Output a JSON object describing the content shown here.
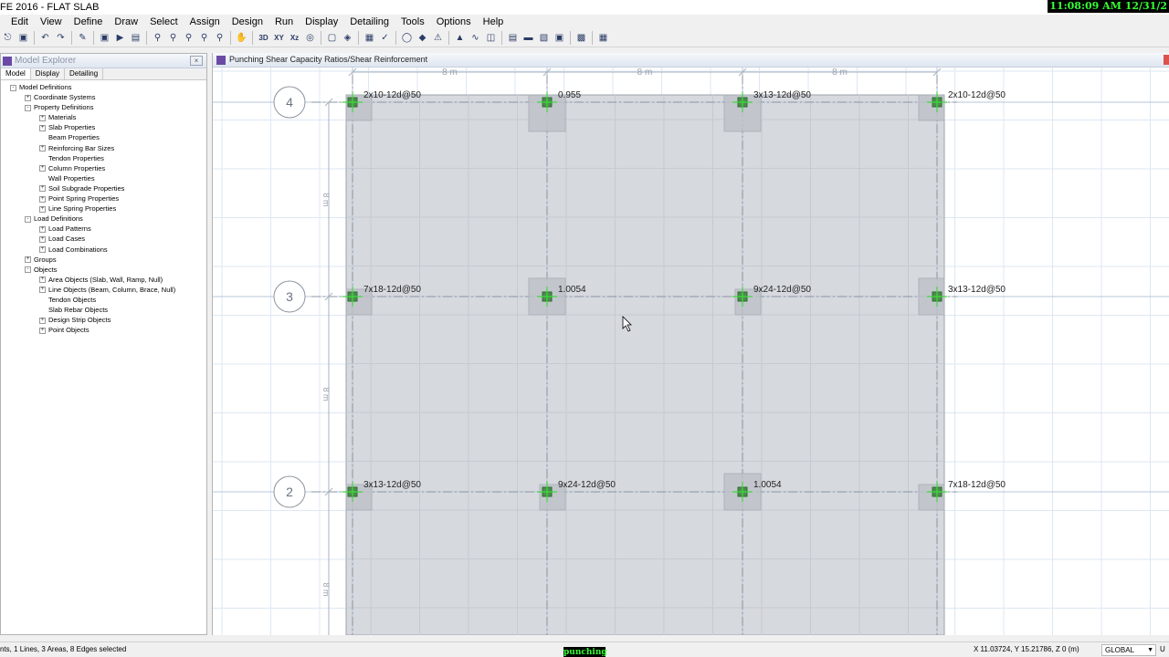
{
  "app": {
    "title": "FE 2016 - FLAT SLAB",
    "clock": "11:08:09 AM 12/31/2"
  },
  "menu": [
    "Edit",
    "View",
    "Define",
    "Draw",
    "Select",
    "Assign",
    "Design",
    "Run",
    "Display",
    "Detailing",
    "Tools",
    "Options",
    "Help"
  ],
  "toolbar": {
    "view_3d": "3D",
    "view_xy": "XY",
    "view_xz": "Xz"
  },
  "model_explorer": {
    "title": "Model Explorer",
    "tabs": [
      "Model",
      "Display",
      "Detailing"
    ],
    "tree": [
      {
        "label": "Model Definitions",
        "level": 0,
        "exp": "-"
      },
      {
        "label": "Coordinate Systems",
        "level": 1,
        "exp": "+"
      },
      {
        "label": "Property Definitions",
        "level": 1,
        "exp": "-"
      },
      {
        "label": "Materials",
        "level": 2,
        "exp": "+"
      },
      {
        "label": "Slab Properties",
        "level": 2,
        "exp": "+"
      },
      {
        "label": "Beam Properties",
        "level": 2,
        "exp": ""
      },
      {
        "label": "Reinforcing Bar Sizes",
        "level": 2,
        "exp": "+"
      },
      {
        "label": "Tendon Properties",
        "level": 2,
        "exp": ""
      },
      {
        "label": "Column Properties",
        "level": 2,
        "exp": "+"
      },
      {
        "label": "Wall Properties",
        "level": 2,
        "exp": ""
      },
      {
        "label": "Soil Subgrade Properties",
        "level": 2,
        "exp": "+"
      },
      {
        "label": "Point Spring Properties",
        "level": 2,
        "exp": "+"
      },
      {
        "label": "Line Spring Properties",
        "level": 2,
        "exp": "+"
      },
      {
        "label": "Load Definitions",
        "level": 1,
        "exp": "-"
      },
      {
        "label": "Load Patterns",
        "level": 2,
        "exp": "+"
      },
      {
        "label": "Load Cases",
        "level": 2,
        "exp": "+"
      },
      {
        "label": "Load Combinations",
        "level": 2,
        "exp": "+"
      },
      {
        "label": "Groups",
        "level": 1,
        "exp": "+"
      },
      {
        "label": "Objects",
        "level": 1,
        "exp": "-"
      },
      {
        "label": "Area Objects (Slab, Wall, Ramp, Null)",
        "level": 2,
        "exp": "+"
      },
      {
        "label": "Line Objects (Beam, Column, Brace, Null)",
        "level": 2,
        "exp": "+"
      },
      {
        "label": "Tendon Objects",
        "level": 2,
        "exp": ""
      },
      {
        "label": "Slab Rebar Objects",
        "level": 2,
        "exp": ""
      },
      {
        "label": "Design Strip Objects",
        "level": 2,
        "exp": "+"
      },
      {
        "label": "Point Objects",
        "level": 2,
        "exp": "+"
      }
    ]
  },
  "drawing": {
    "title": "Punching Shear Capacity Ratios/Shear Reinforcement",
    "dimensions": [
      "8 m",
      "8 m",
      "8 m"
    ],
    "vertical_dims": [
      "8 m",
      "8 m",
      "8 m"
    ],
    "grid_rows": [
      "4",
      "3",
      "2"
    ],
    "labels": [
      {
        "row": 0,
        "col": 0,
        "text": "2x10-12d@50"
      },
      {
        "row": 0,
        "col": 1,
        "text": "0.955"
      },
      {
        "row": 0,
        "col": 2,
        "text": "3x13-12d@50"
      },
      {
        "row": 0,
        "col": 3,
        "text": "2x10-12d@50"
      },
      {
        "row": 1,
        "col": 0,
        "text": "7x18-12d@50"
      },
      {
        "row": 1,
        "col": 1,
        "text": "1.0054"
      },
      {
        "row": 1,
        "col": 2,
        "text": "9x24-12d@50"
      },
      {
        "row": 1,
        "col": 3,
        "text": "3x13-12d@50"
      },
      {
        "row": 2,
        "col": 0,
        "text": "3x13-12d@50"
      },
      {
        "row": 2,
        "col": 1,
        "text": "9x24-12d@50"
      },
      {
        "row": 2,
        "col": 2,
        "text": "1.0054"
      },
      {
        "row": 2,
        "col": 3,
        "text": "7x18-12d@50"
      }
    ]
  },
  "status": {
    "selection": "nts, 1 Lines, 3 Areas, 8 Edges selected",
    "mode": "punching",
    "coords": "X 11.03724,  Y 15.21786,  Z 0   (m)",
    "coord_system": "GLOBAL",
    "units": "U"
  }
}
